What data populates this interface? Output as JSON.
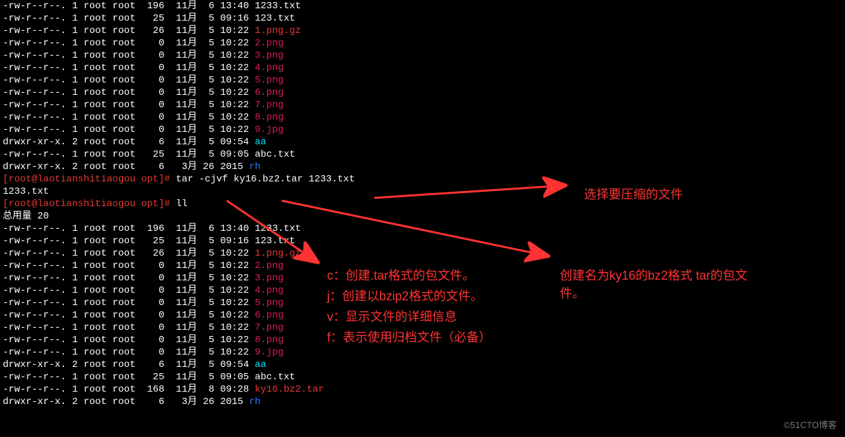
{
  "listing1": [
    {
      "perm": "-rw-r--r--.",
      "links": "1",
      "user": "root",
      "group": "root",
      "size": "196",
      "month": "11月",
      "day": "6",
      "time": "13:40",
      "name": "1233.txt",
      "cls": "white"
    },
    {
      "perm": "-rw-r--r--.",
      "links": "1",
      "user": "root",
      "group": "root",
      "size": "25",
      "month": "11月",
      "day": "5",
      "time": "09:16",
      "name": "123.txt",
      "cls": "white"
    },
    {
      "perm": "-rw-r--r--.",
      "links": "1",
      "user": "root",
      "group": "root",
      "size": "26",
      "month": "11月",
      "day": "5",
      "time": "10:22",
      "name": "1.png.gz",
      "cls": "red"
    },
    {
      "perm": "-rw-r--r--.",
      "links": "1",
      "user": "root",
      "group": "root",
      "size": "0",
      "month": "11月",
      "day": "5",
      "time": "10:22",
      "name": "2.png",
      "cls": "magenta"
    },
    {
      "perm": "-rw-r--r--.",
      "links": "1",
      "user": "root",
      "group": "root",
      "size": "0",
      "month": "11月",
      "day": "5",
      "time": "10:22",
      "name": "3.png",
      "cls": "magenta"
    },
    {
      "perm": "-rw-r--r--.",
      "links": "1",
      "user": "root",
      "group": "root",
      "size": "0",
      "month": "11月",
      "day": "5",
      "time": "10:22",
      "name": "4.png",
      "cls": "magenta"
    },
    {
      "perm": "-rw-r--r--.",
      "links": "1",
      "user": "root",
      "group": "root",
      "size": "0",
      "month": "11月",
      "day": "5",
      "time": "10:22",
      "name": "5.png",
      "cls": "magenta"
    },
    {
      "perm": "-rw-r--r--.",
      "links": "1",
      "user": "root",
      "group": "root",
      "size": "0",
      "month": "11月",
      "day": "5",
      "time": "10:22",
      "name": "6.png",
      "cls": "magenta"
    },
    {
      "perm": "-rw-r--r--.",
      "links": "1",
      "user": "root",
      "group": "root",
      "size": "0",
      "month": "11月",
      "day": "5",
      "time": "10:22",
      "name": "7.png",
      "cls": "magenta"
    },
    {
      "perm": "-rw-r--r--.",
      "links": "1",
      "user": "root",
      "group": "root",
      "size": "0",
      "month": "11月",
      "day": "5",
      "time": "10:22",
      "name": "8.png",
      "cls": "magenta"
    },
    {
      "perm": "-rw-r--r--.",
      "links": "1",
      "user": "root",
      "group": "root",
      "size": "0",
      "month": "11月",
      "day": "5",
      "time": "10:22",
      "name": "9.jpg",
      "cls": "magenta"
    },
    {
      "perm": "drwxr-xr-x.",
      "links": "2",
      "user": "root",
      "group": "root",
      "size": "6",
      "month": "11月",
      "day": "5",
      "time": "09:54",
      "name": "aa",
      "cls": "cyan"
    },
    {
      "perm": "-rw-r--r--.",
      "links": "1",
      "user": "root",
      "group": "root",
      "size": "25",
      "month": "11月",
      "day": "5",
      "time": "09:05",
      "name": "abc.txt",
      "cls": "white"
    },
    {
      "perm": "drwxr-xr-x.",
      "links": "2",
      "user": "root",
      "group": "root",
      "size": "6",
      "month": "3月",
      "day": "26",
      "time": "2015",
      "name": "rh",
      "cls": "blue"
    }
  ],
  "prompt1": {
    "host": "[root@laotianshitiaogou opt]#",
    "cmd": " tar -cjvf ky16.bz2.tar 1233.txt"
  },
  "output1": "1233.txt",
  "prompt2": {
    "host": "[root@laotianshitiaogou opt]#",
    "cmd": " ll"
  },
  "total": "总用量 20",
  "listing2": [
    {
      "perm": "-rw-r--r--.",
      "links": "1",
      "user": "root",
      "group": "root",
      "size": "196",
      "month": "11月",
      "day": "6",
      "time": "13:40",
      "name": "1233.txt",
      "cls": "white"
    },
    {
      "perm": "-rw-r--r--.",
      "links": "1",
      "user": "root",
      "group": "root",
      "size": "25",
      "month": "11月",
      "day": "5",
      "time": "09:16",
      "name": "123.txt",
      "cls": "white"
    },
    {
      "perm": "-rw-r--r--.",
      "links": "1",
      "user": "root",
      "group": "root",
      "size": "26",
      "month": "11月",
      "day": "5",
      "time": "10:22",
      "name": "1.png.gz",
      "cls": "red"
    },
    {
      "perm": "-rw-r--r--.",
      "links": "1",
      "user": "root",
      "group": "root",
      "size": "0",
      "month": "11月",
      "day": "5",
      "time": "10:22",
      "name": "2.png",
      "cls": "magenta"
    },
    {
      "perm": "-rw-r--r--.",
      "links": "1",
      "user": "root",
      "group": "root",
      "size": "0",
      "month": "11月",
      "day": "5",
      "time": "10:22",
      "name": "3.png",
      "cls": "magenta"
    },
    {
      "perm": "-rw-r--r--.",
      "links": "1",
      "user": "root",
      "group": "root",
      "size": "0",
      "month": "11月",
      "day": "5",
      "time": "10:22",
      "name": "4.png",
      "cls": "magenta"
    },
    {
      "perm": "-rw-r--r--.",
      "links": "1",
      "user": "root",
      "group": "root",
      "size": "0",
      "month": "11月",
      "day": "5",
      "time": "10:22",
      "name": "5.png",
      "cls": "magenta"
    },
    {
      "perm": "-rw-r--r--.",
      "links": "1",
      "user": "root",
      "group": "root",
      "size": "0",
      "month": "11月",
      "day": "5",
      "time": "10:22",
      "name": "6.png",
      "cls": "magenta"
    },
    {
      "perm": "-rw-r--r--.",
      "links": "1",
      "user": "root",
      "group": "root",
      "size": "0",
      "month": "11月",
      "day": "5",
      "time": "10:22",
      "name": "7.png",
      "cls": "magenta"
    },
    {
      "perm": "-rw-r--r--.",
      "links": "1",
      "user": "root",
      "group": "root",
      "size": "0",
      "month": "11月",
      "day": "5",
      "time": "10:22",
      "name": "8.png",
      "cls": "magenta"
    },
    {
      "perm": "-rw-r--r--.",
      "links": "1",
      "user": "root",
      "group": "root",
      "size": "0",
      "month": "11月",
      "day": "5",
      "time": "10:22",
      "name": "9.jpg",
      "cls": "magenta"
    },
    {
      "perm": "drwxr-xr-x.",
      "links": "2",
      "user": "root",
      "group": "root",
      "size": "6",
      "month": "11月",
      "day": "5",
      "time": "09:54",
      "name": "aa",
      "cls": "cyan"
    },
    {
      "perm": "-rw-r--r--.",
      "links": "1",
      "user": "root",
      "group": "root",
      "size": "25",
      "month": "11月",
      "day": "5",
      "time": "09:05",
      "name": "abc.txt",
      "cls": "white"
    },
    {
      "perm": "-rw-r--r--.",
      "links": "1",
      "user": "root",
      "group": "root",
      "size": "168",
      "month": "11月",
      "day": "8",
      "time": "09:28",
      "name": "ky16.bz2.tar",
      "cls": "red"
    },
    {
      "perm": "drwxr-xr-x.",
      "links": "2",
      "user": "root",
      "group": "root",
      "size": "6",
      "month": "3月",
      "day": "26",
      "time": "2015",
      "name": "rh",
      "cls": "blue"
    }
  ],
  "annotations": {
    "a1": "选择要压缩的文件",
    "a2_l1": "创建名为ky16的bz2格式 tar的包文",
    "a2_l2": "件。",
    "opt_c": "c：创建.tar格式的包文件。",
    "opt_j": "j：创建以bzip2格式的文件。",
    "opt_v": "v：显示文件的详细信息",
    "opt_f": "f：表示使用归档文件（必备）"
  },
  "watermark": "©51CTO博客"
}
